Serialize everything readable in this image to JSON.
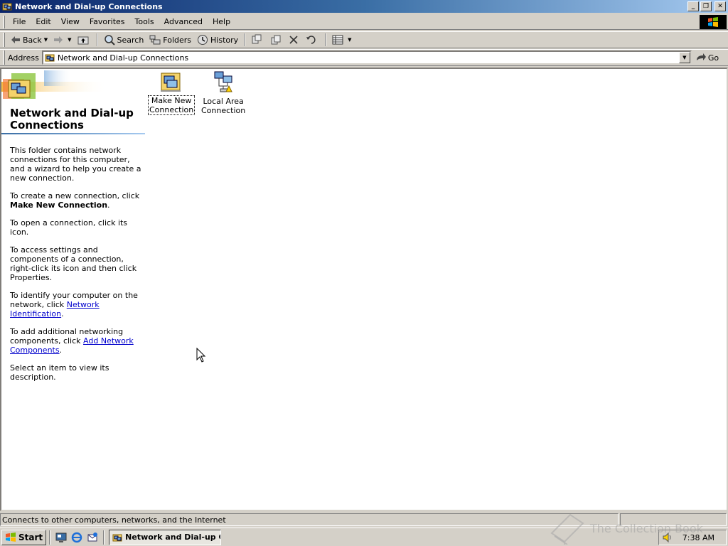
{
  "window": {
    "title": "Network and Dial-up Connections",
    "controls": {
      "minimize": "_",
      "maximize": "❐",
      "close": "✕"
    }
  },
  "menu": [
    "File",
    "Edit",
    "View",
    "Favorites",
    "Tools",
    "Advanced",
    "Help"
  ],
  "toolbar": {
    "back": "Back",
    "search": "Search",
    "folders": "Folders",
    "history": "History"
  },
  "address": {
    "label": "Address",
    "value": "Network and Dial-up Connections",
    "go": "Go"
  },
  "sidepanel": {
    "title": "Network and Dial-up Connections",
    "p1": "This folder contains network connections for this computer, and a wizard to help you create a new connection.",
    "p2_pre": "To create a new connection, click",
    "p2_bold": "Make New Connection",
    "p2_post": ".",
    "p3": "To open a connection, click its icon.",
    "p4": "To access settings and components of a connection, right-click its icon and then click Properties.",
    "p5_pre": "To identify your computer on the network, click",
    "p5_link": "Network Identification",
    "p5_post": ".",
    "p6_pre": "To add additional networking components, click",
    "p6_link": "Add Network Components",
    "p6_post": ".",
    "p7": "Select an item to view its description."
  },
  "items": [
    {
      "label_line1": "Make New",
      "label_line2": "Connection",
      "icon": "make-new-connection-icon"
    },
    {
      "label_line1": "Local Area",
      "label_line2": "Connection",
      "icon": "local-area-connection-icon"
    }
  ],
  "status": {
    "text": "Connects to other computers, networks, and the Internet"
  },
  "taskbar": {
    "start": "Start",
    "task": "Network and Dial-up Co",
    "clock": "7:38 AM"
  },
  "watermark": "The Collection Book",
  "colors": {
    "title_start": "#0a246a",
    "title_end": "#a6caf0",
    "face": "#d4d0c8",
    "link": "#0000cc"
  }
}
